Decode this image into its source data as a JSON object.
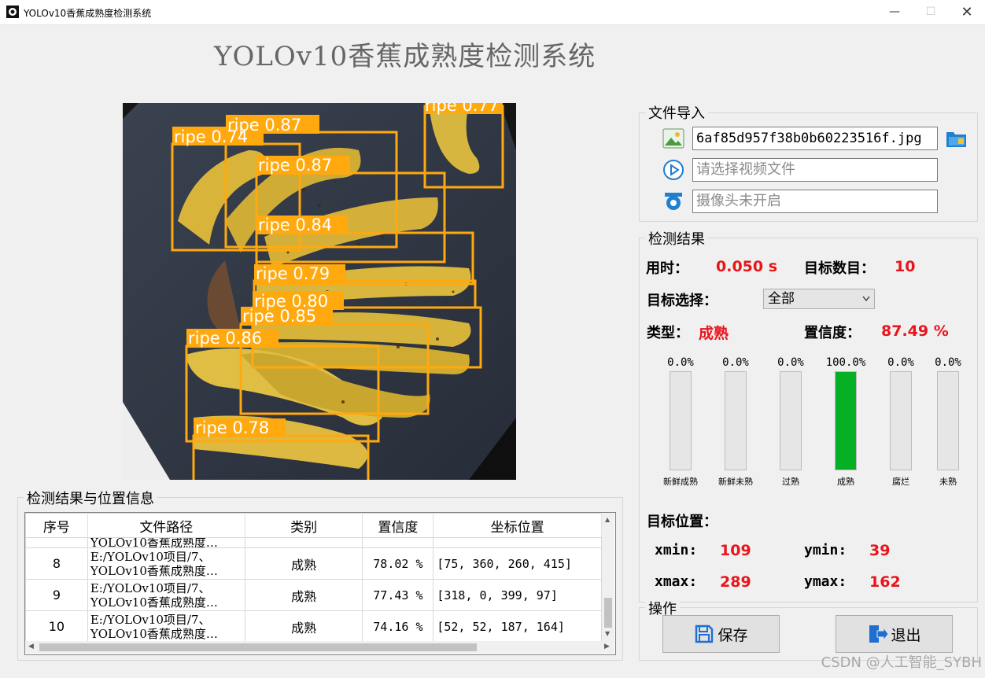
{
  "window": {
    "title": "YOLOv10香蕉成熟度检测系统"
  },
  "app_title": "YOLOv10香蕉成熟度检测系统",
  "image": {
    "detections": [
      {
        "label": "ripe 0.77"
      },
      {
        "label": "ripe 0.87"
      },
      {
        "label": "ripe 0.74"
      },
      {
        "label": "ripe 0.87"
      },
      {
        "label": "ripe 0.84"
      },
      {
        "label": "ripe 0.79"
      },
      {
        "label": "ripe 0.80"
      },
      {
        "label": "ripe 0.85"
      },
      {
        "label": "ripe 0.86"
      },
      {
        "label": "ripe 0.78"
      }
    ],
    "box_color": "#ffa90f"
  },
  "file_import": {
    "title": "文件导入",
    "image_file_value": "6af85d957f38b0b60223516f.jpg",
    "video_placeholder": "请选择视频文件",
    "camera_placeholder": "摄像头未开启"
  },
  "results": {
    "title": "检测结果",
    "time_label": "用时：",
    "time_value": "0.050 s",
    "count_label": "目标数目：",
    "count_value": "10",
    "select_label": "目标选择：",
    "select_value": "全部",
    "type_label": "类型：",
    "type_value": "成熟",
    "conf_label": "置信度：",
    "conf_value": "87.49 %",
    "bars": [
      {
        "label": "新鲜成熟",
        "percent_text": "0.0%",
        "fraction": 0.0
      },
      {
        "label": "新鲜未熟",
        "percent_text": "0.0%",
        "fraction": 0.0
      },
      {
        "label": "过熟",
        "percent_text": "0.0%",
        "fraction": 0.0
      },
      {
        "label": "成熟",
        "percent_text": "100.0%",
        "fraction": 1.0
      },
      {
        "label": "腐烂",
        "percent_text": "0.0%",
        "fraction": 0.0
      },
      {
        "label": "未熟",
        "percent_text": "0.0%",
        "fraction": 0.0
      }
    ],
    "bar_fill_color": "#06b025",
    "position_label": "目标位置：",
    "xmin_label": "xmin:",
    "xmin_value": "109",
    "ymin_label": "ymin:",
    "ymin_value": "39",
    "xmax_label": "xmax:",
    "xmax_value": "289",
    "ymax_label": "ymax:",
    "ymax_value": "162"
  },
  "operations": {
    "title": "操作",
    "save_label": "保存",
    "exit_label": "退出"
  },
  "table": {
    "title": "检测结果与位置信息",
    "headers": [
      "序号",
      "文件路径",
      "类别",
      "置信度",
      "坐标位置"
    ],
    "partial_row": {
      "path": "YOLOv10香蕉成熟度…"
    },
    "rows": [
      {
        "index": "8",
        "path1": "E:/YOLOv10项目/7、",
        "path2": "YOLOv10香蕉成熟度…",
        "category": "成熟",
        "confidence": "78.02 %",
        "coords": "[75, 360, 260, 415]"
      },
      {
        "index": "9",
        "path1": "E:/YOLOv10项目/7、",
        "path2": "YOLOv10香蕉成熟度…",
        "category": "成熟",
        "confidence": "77.43 %",
        "coords": "[318, 0, 399, 97]"
      },
      {
        "index": "10",
        "path1": "E:/YOLOv10项目/7、",
        "path2": "YOLOv10香蕉成熟度…",
        "category": "成熟",
        "confidence": "74.16 %",
        "coords": "[52, 52, 187, 164]"
      }
    ]
  },
  "watermark": "CSDN @人工智能_SYBH"
}
